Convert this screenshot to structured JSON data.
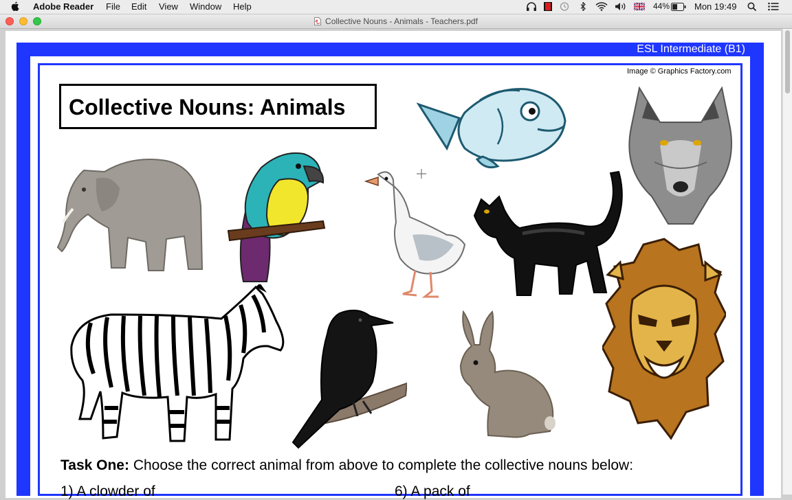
{
  "menubar": {
    "app_name": "Adobe Reader",
    "menus": [
      "File",
      "Edit",
      "View",
      "Window",
      "Help"
    ],
    "battery_percent": "44%",
    "clock": "Mon 19:49"
  },
  "window": {
    "title": "Collective Nouns - Animals - Teachers.pdf"
  },
  "document": {
    "level": "ESL Intermediate (B1)",
    "credit": "Image © Graphics Factory.com",
    "title": "Collective Nouns: Animals",
    "task_label": "Task One:",
    "task_text": " Choose the correct animal from above to complete the collective nouns below:",
    "item_1": "1)  A clowder of",
    "item_6": "6)  A pack of"
  },
  "colors": {
    "frame_blue": "#1f36ff"
  }
}
